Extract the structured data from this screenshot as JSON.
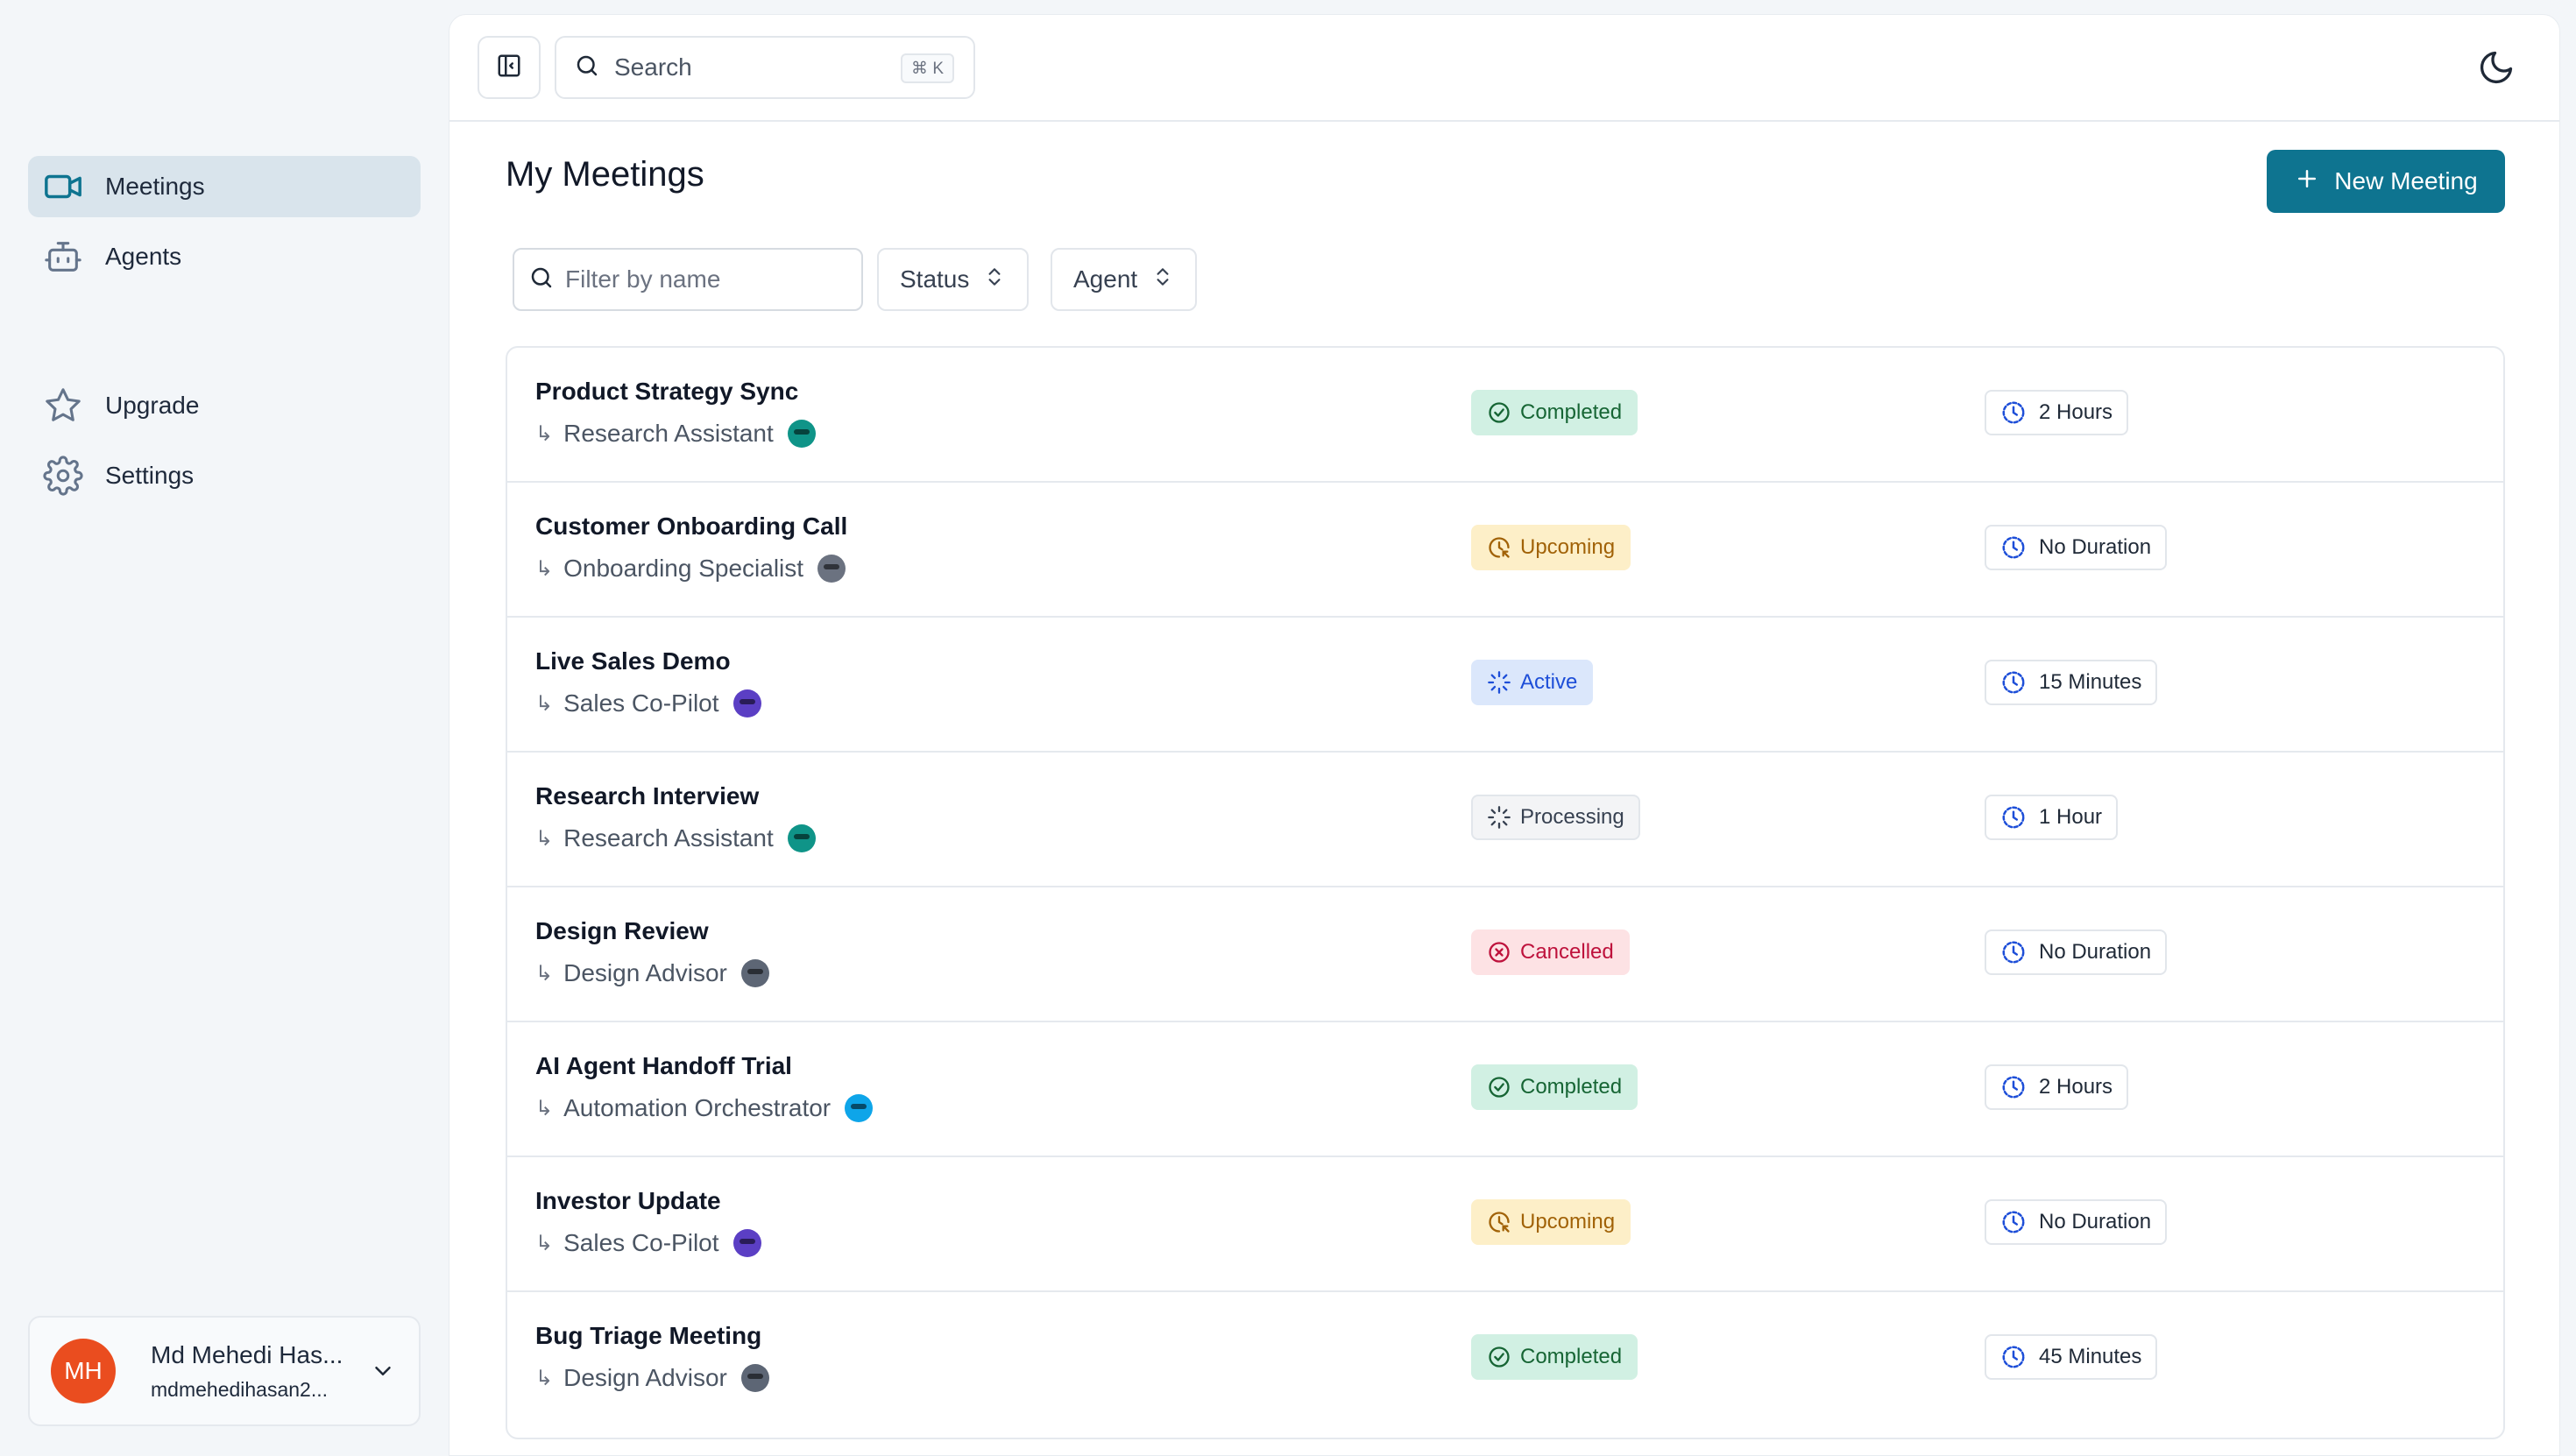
{
  "sidebar": {
    "nav": [
      {
        "label": "Meetings",
        "icon": "video-icon",
        "active": true
      },
      {
        "label": "Agents",
        "icon": "bot-icon",
        "active": false
      }
    ],
    "secondary": [
      {
        "label": "Upgrade",
        "icon": "star-icon"
      },
      {
        "label": "Settings",
        "icon": "gear-icon"
      }
    ],
    "user": {
      "initials": "MH",
      "name": "Md Mehedi Has...",
      "email": "mdmehedihasan2..."
    }
  },
  "topbar": {
    "search_placeholder": "Search",
    "search_shortcut": "⌘ K"
  },
  "page": {
    "title": "My Meetings",
    "new_meeting_label": "New Meeting",
    "filter_placeholder": "Filter by name",
    "status_filter_label": "Status",
    "agent_filter_label": "Agent"
  },
  "colors": {
    "accent": "#0e7490",
    "completed_bg": "#d1f0e3",
    "completed_fg": "#166534",
    "upcoming_bg": "#fdefc8",
    "upcoming_fg": "#a16207",
    "active_bg": "#dbe7fb",
    "active_fg": "#1d4ed8",
    "processing_bg": "#f3f4f6",
    "processing_fg": "#374151",
    "cancelled_bg": "#fde2e4",
    "cancelled_fg": "#be123c"
  },
  "meetings": [
    {
      "title": "Product Strategy Sync",
      "agent": "Research Assistant",
      "agent_color": "#0f9488",
      "status": "Completed",
      "duration": "2 Hours"
    },
    {
      "title": "Customer Onboarding Call",
      "agent": "Onboarding Specialist",
      "agent_color": "#6b7280",
      "status": "Upcoming",
      "duration": "No Duration"
    },
    {
      "title": "Live Sales Demo",
      "agent": "Sales Co-Pilot",
      "agent_color": "#5b3fc4",
      "status": "Active",
      "duration": "15 Minutes"
    },
    {
      "title": "Research Interview",
      "agent": "Research Assistant",
      "agent_color": "#0f9488",
      "status": "Processing",
      "duration": "1 Hour"
    },
    {
      "title": "Design Review",
      "agent": "Design Advisor",
      "agent_color": "#5d6675",
      "status": "Cancelled",
      "duration": "No Duration"
    },
    {
      "title": "AI Agent Handoff Trial",
      "agent": "Automation Orchestrator",
      "agent_color": "#0ea5e9",
      "status": "Completed",
      "duration": "2 Hours"
    },
    {
      "title": "Investor Update",
      "agent": "Sales Co-Pilot",
      "agent_color": "#5b3fc4",
      "status": "Upcoming",
      "duration": "No Duration"
    },
    {
      "title": "Bug Triage Meeting",
      "agent": "Design Advisor",
      "agent_color": "#5d6675",
      "status": "Completed",
      "duration": "45 Minutes"
    }
  ]
}
